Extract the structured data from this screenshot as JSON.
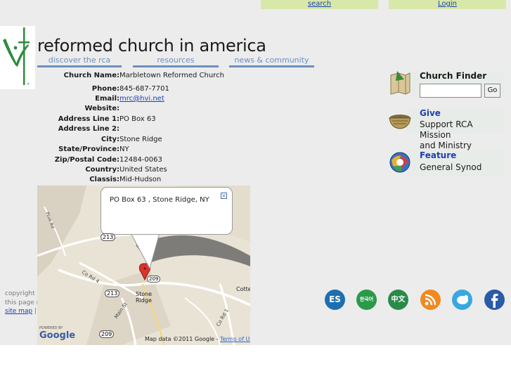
{
  "topbar": {
    "search_label": "search",
    "login_label": "Login"
  },
  "site": {
    "title": "reformed church in america"
  },
  "nav": {
    "discover": "discover the rca",
    "resources": "resources",
    "news": "news & community"
  },
  "church": {
    "name_label": "Church Name:",
    "name": "Marbletown Reformed Church",
    "phone_label": "Phone:",
    "phone": "845-687-7701",
    "email_label": "Email:",
    "email": "mrc@hvi.net",
    "website_label": "Website:",
    "website": "",
    "address1_label": "Address Line 1:",
    "address1": "PO Box 63",
    "address2_label": "Address Line 2:",
    "address2": "",
    "city_label": "City:",
    "city": "Stone Ridge",
    "state_label": "State/Province:",
    "state": "NY",
    "zip_label": "Zip/Postal Code:",
    "zip": "12484-0063",
    "country_label": "Country:",
    "country": "United States",
    "classis_label": "Classis:",
    "classis": "Mid-Hudson"
  },
  "map": {
    "info_text": "PO Box 63 , Stone Ridge, NY",
    "close_glyph": "×",
    "town_label_1": "Stone",
    "town_label_2": "Ridge",
    "cotte_label": "Cotte",
    "road_label_213a": "213",
    "road_label_213b": "213",
    "road_label_209a": "209",
    "road_label_209b": "209",
    "road_label_co4": "Co Rd 4",
    "road_label_co1": "Co Rd 1",
    "road_label_main": "Main St",
    "road_label_peak": "Peak Rd",
    "powered_by": "POWERED BY",
    "google_logo": "Google",
    "attribution": "Map data ©2011 Google - ",
    "terms_label": "Terms of Use"
  },
  "sidebar": {
    "finder_title": "Church Finder",
    "finder_go": "Go",
    "give_title": "Give",
    "give_sub_1": "Support RCA Mission",
    "give_sub_2": "and Ministry",
    "feature_title": "Feature",
    "feature_sub": "General Synod"
  },
  "footer": {
    "line1": "copyright ©",
    "line2": "this page m",
    "sitemap": "site map",
    "sep": "| c"
  },
  "social": {
    "es": "ES",
    "ko": "한국어",
    "zh": "中文"
  },
  "colors": {
    "accent_green": "#d8e8a8",
    "nav_blue": "#6c8fc0",
    "link_blue": "#1a3fb5",
    "page_bg": "#ececec"
  }
}
